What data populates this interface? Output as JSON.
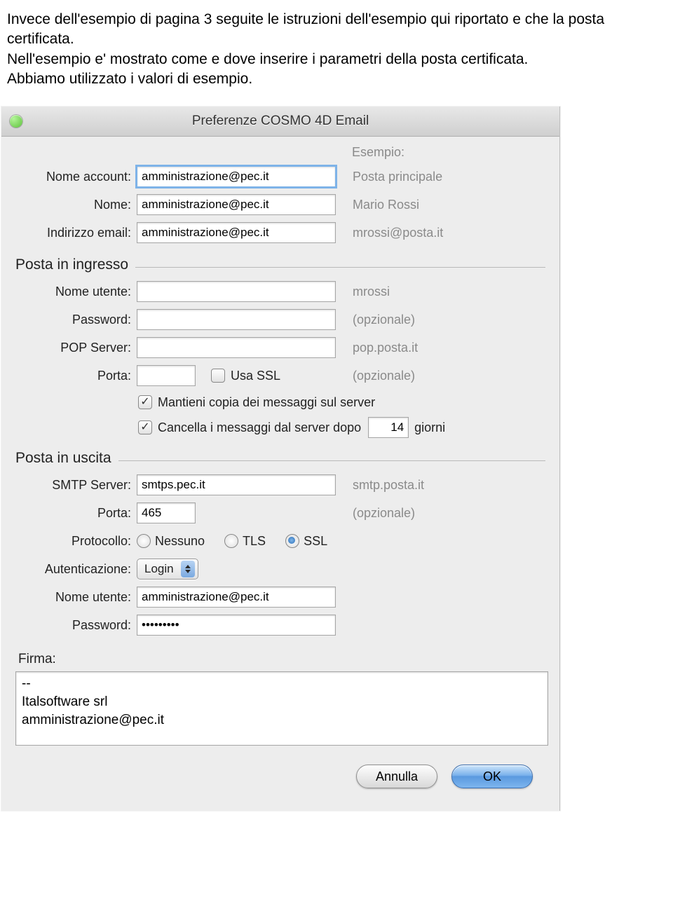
{
  "doc": {
    "p1": "Invece dell'esempio di pagina 3 seguite le istruzioni dell'esempio qui riportato e che la posta certificata.",
    "p2": "Nell'esempio e' mostrato come e dove inserire i parametri della posta certificata.",
    "p3": "Abbiamo utilizzato i valori di esempio."
  },
  "window": {
    "title": "Preferenze COSMO 4D Email"
  },
  "header": {
    "esempio": "Esempio:"
  },
  "account": {
    "nome_account_label": "Nome account:",
    "nome_account_value": "amministrazione@pec.it",
    "nome_account_hint": "Posta principale",
    "nome_label": "Nome:",
    "nome_value": "amministrazione@pec.it",
    "nome_hint": "Mario Rossi",
    "indirizzo_label": "Indirizzo email:",
    "indirizzo_value": "amministrazione@pec.it",
    "indirizzo_hint": "mrossi@posta.it"
  },
  "ingresso": {
    "section": "Posta in ingresso",
    "utente_label": "Nome utente:",
    "utente_value": "",
    "utente_hint": "mrossi",
    "password_label": "Password:",
    "password_value": "",
    "password_hint": "(opzionale)",
    "pop_label": "POP Server:",
    "pop_value": "",
    "pop_hint": "pop.posta.it",
    "porta_label": "Porta:",
    "porta_value": "",
    "porta_hint": "(opzionale)",
    "usa_ssl": "Usa SSL",
    "usa_ssl_checked": false,
    "mantieni": "Mantieni copia dei messaggi sul server",
    "mantieni_checked": true,
    "cancella_pre": "Cancella i messaggi dal server dopo",
    "cancella_days": "14",
    "cancella_post": "giorni",
    "cancella_checked": true
  },
  "uscita": {
    "section": "Posta in uscita",
    "smtp_label": "SMTP Server:",
    "smtp_value": "smtps.pec.it",
    "smtp_hint": "smtp.posta.it",
    "porta_label": "Porta:",
    "porta_value": "465",
    "porta_hint": "(opzionale)",
    "protocollo_label": "Protocollo:",
    "proto_none": "Nessuno",
    "proto_tls": "TLS",
    "proto_ssl": "SSL",
    "auth_label": "Autenticazione:",
    "auth_value": "Login",
    "utente_label": "Nome utente:",
    "utente_value": "amministrazione@pec.it",
    "password_label": "Password:",
    "password_value": "•••••••••"
  },
  "firma": {
    "label": "Firma:",
    "value": "--\nItalsoftware srl\namministrazione@pec.it"
  },
  "buttons": {
    "cancel": "Annulla",
    "ok": "OK"
  }
}
